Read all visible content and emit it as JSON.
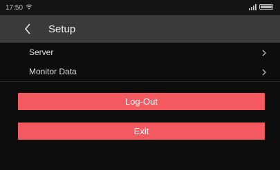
{
  "status_bar": {
    "time": "17:50",
    "wifi_icon": "wifi-icon"
  },
  "header": {
    "title": "Setup",
    "back_icon": "chevron-left-icon"
  },
  "menu": [
    {
      "label": "Server",
      "icon": "chevron-right-icon"
    },
    {
      "label": "Monitor Data",
      "icon": "chevron-right-icon"
    }
  ],
  "buttons": {
    "logout_label": "Log-Out",
    "exit_label": "Exit"
  },
  "colors": {
    "accent": "#f25a5f",
    "header_bg": "#3a3a3a",
    "background": "#0d0d0d"
  }
}
